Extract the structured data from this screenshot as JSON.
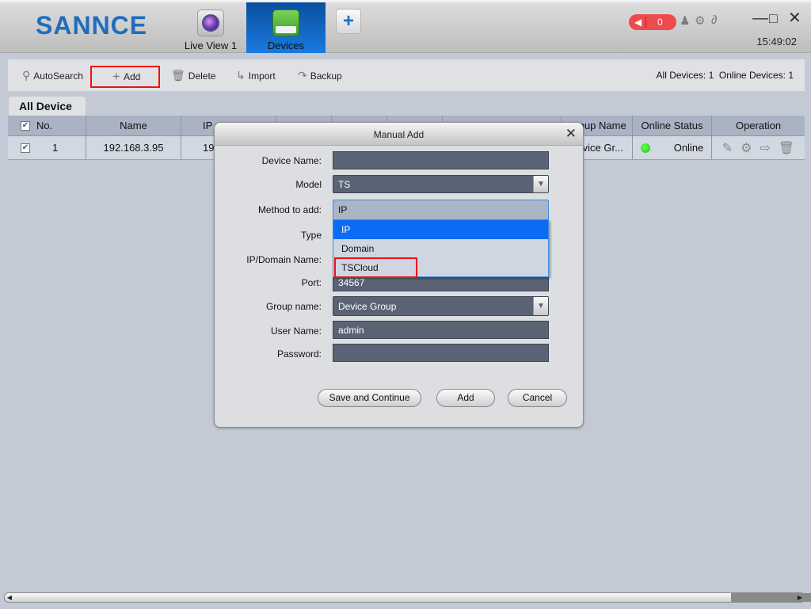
{
  "app": {
    "logo": "SANNCE",
    "tabs": [
      {
        "label": "Live View 1",
        "icon": "camera-lens-icon",
        "active": false
      },
      {
        "label": "Devices",
        "icon": "devices-icon",
        "active": true
      }
    ],
    "add_tab_label": "+",
    "alarm_count": "0",
    "clock": "15:49:02",
    "accent_color": "#1a7ae0"
  },
  "toolbar": {
    "autosearch": "AutoSearch",
    "add": "Add",
    "delete": "Delete",
    "import": "Import",
    "backup": "Backup",
    "all_devices_label": "All Devices:",
    "all_devices_count": "1",
    "online_devices_label": "Online Devices:",
    "online_devices_count": "1"
  },
  "device_tab": "All Device",
  "table": {
    "headers": {
      "no": "No.",
      "name": "Name",
      "ip": "IP",
      "group": "Group Name",
      "status": "Online Status",
      "operation": "Operation"
    },
    "rows": [
      {
        "checked": true,
        "no": "1",
        "name": "192.168.3.95",
        "ip": "19",
        "group": "Device Gr...",
        "status": "Online"
      }
    ]
  },
  "dialog": {
    "title": "Manual Add",
    "labels": {
      "device_name": "Device Name:",
      "model": "Model",
      "method": "Method to add:",
      "type": "Type",
      "ip_domain": "IP/Domain Name:",
      "port": "Port:",
      "group_name": "Group name:",
      "user_name": "User Name:",
      "password": "Password:"
    },
    "values": {
      "device_name": "",
      "model": "TS",
      "method": "IP",
      "port": "34567",
      "group_name": "Device Group",
      "user_name": "admin",
      "password": ""
    },
    "method_options": [
      "IP",
      "Domain",
      "TSCloud"
    ],
    "method_selected_index": 0,
    "buttons": {
      "save_continue": "Save and Continue",
      "add": "Add",
      "cancel": "Cancel"
    }
  }
}
